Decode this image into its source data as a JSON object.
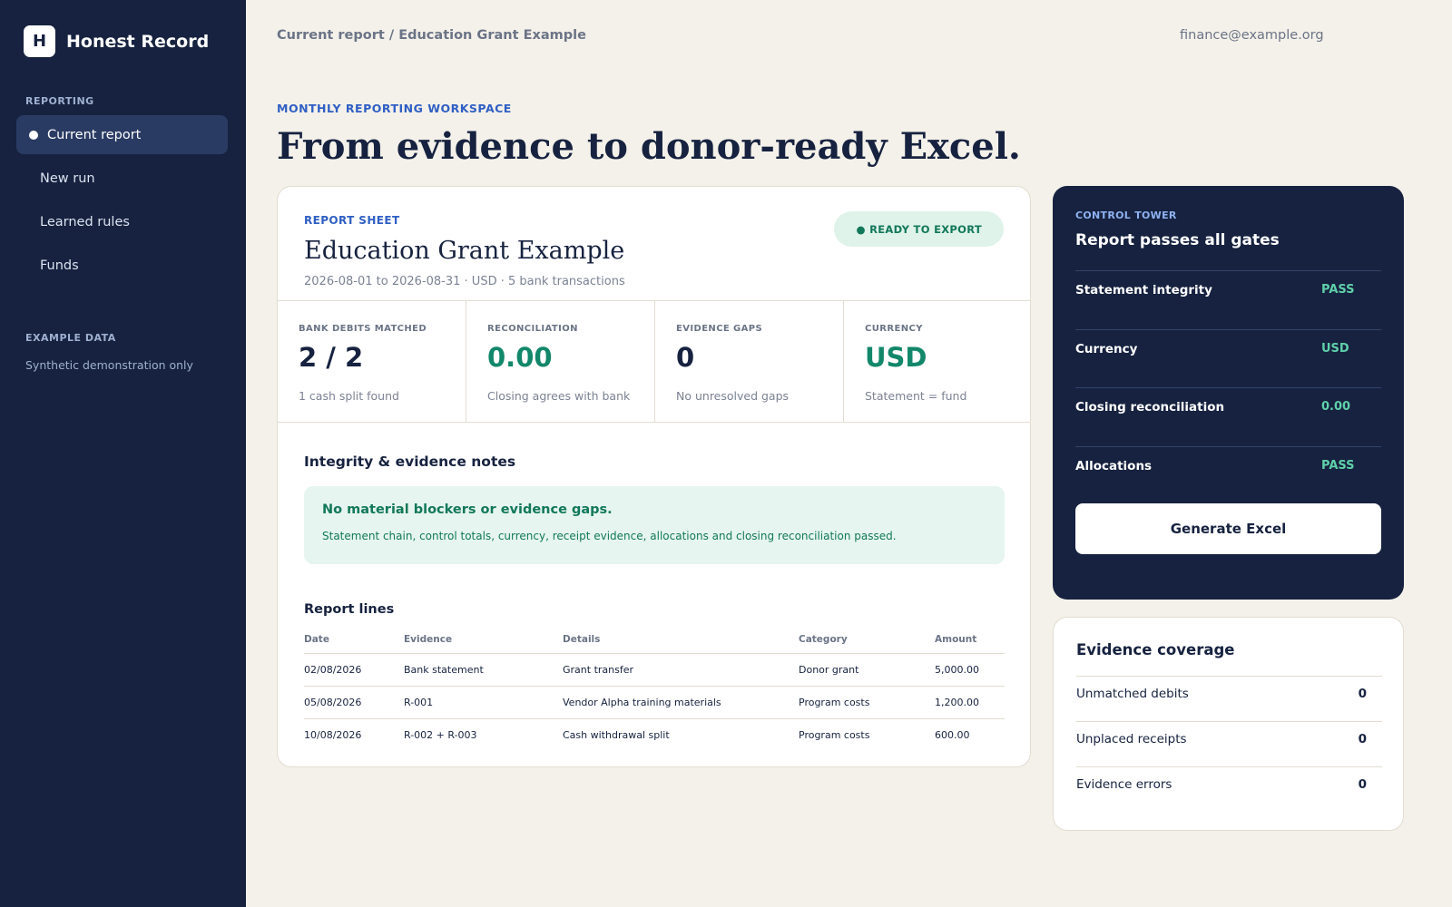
{
  "app": {
    "logo_letter": "H",
    "name": "Honest Record"
  },
  "sidebar": {
    "section_reporting": "REPORTING",
    "items": [
      {
        "label": "Current report",
        "active": true
      },
      {
        "label": "New run"
      },
      {
        "label": "Learned rules"
      },
      {
        "label": "Funds"
      }
    ],
    "section_example": "EXAMPLE DATA",
    "example_note": "Synthetic demonstration only"
  },
  "header": {
    "breadcrumb": "Current report / Education Grant Example",
    "user_email": "finance@example.org"
  },
  "hero": {
    "eyebrow": "MONTHLY REPORTING WORKSPACE",
    "title": "From evidence to donor-ready Excel."
  },
  "report": {
    "label": "REPORT SHEET",
    "title": "Education Grant Example",
    "subtitle": "2026-08-01 to 2026-08-31 · USD · 5 bank transactions",
    "status": "● READY TO EXPORT",
    "metrics": [
      {
        "label": "BANK DEBITS MATCHED",
        "value": "2 / 2",
        "note": "1 cash split found"
      },
      {
        "label": "RECONCILIATION",
        "value": "0.00",
        "note": "Closing agrees with bank"
      },
      {
        "label": "EVIDENCE GAPS",
        "value": "0",
        "note": "No unresolved gaps"
      },
      {
        "label": "CURRENCY",
        "value": "USD",
        "note": "Statement = fund"
      }
    ],
    "notes_title": "Integrity & evidence notes",
    "notes_box_title": "No material blockers or evidence gaps.",
    "notes_box_text": "Statement chain, control totals, currency, receipt evidence, allocations and closing reconciliation passed.",
    "lines_title": "Report lines",
    "columns": [
      "Date",
      "Evidence",
      "Details",
      "Category",
      "Amount"
    ],
    "rows": [
      [
        "02/08/2026",
        "Bank statement",
        "Grant transfer",
        "Donor grant",
        "5,000.00"
      ],
      [
        "05/08/2026",
        "R-001",
        "Vendor Alpha training materials",
        "Program costs",
        "1,200.00"
      ],
      [
        "10/08/2026",
        "R-002 + R-003",
        "Cash withdrawal split",
        "Program costs",
        "600.00"
      ]
    ]
  },
  "tower": {
    "label": "CONTROL TOWER",
    "title": "Report passes all gates",
    "rows": [
      {
        "label": "Statement integrity",
        "value": "PASS"
      },
      {
        "label": "Currency",
        "value": "USD"
      },
      {
        "label": "Closing reconciliation",
        "value": "0.00"
      },
      {
        "label": "Allocations",
        "value": "PASS"
      }
    ],
    "button": "Generate Excel"
  },
  "coverage": {
    "title": "Evidence coverage",
    "rows": [
      {
        "label": "Unmatched debits",
        "value": "0"
      },
      {
        "label": "Unplaced receipts",
        "value": "0"
      },
      {
        "label": "Evidence errors",
        "value": "0"
      }
    ]
  }
}
